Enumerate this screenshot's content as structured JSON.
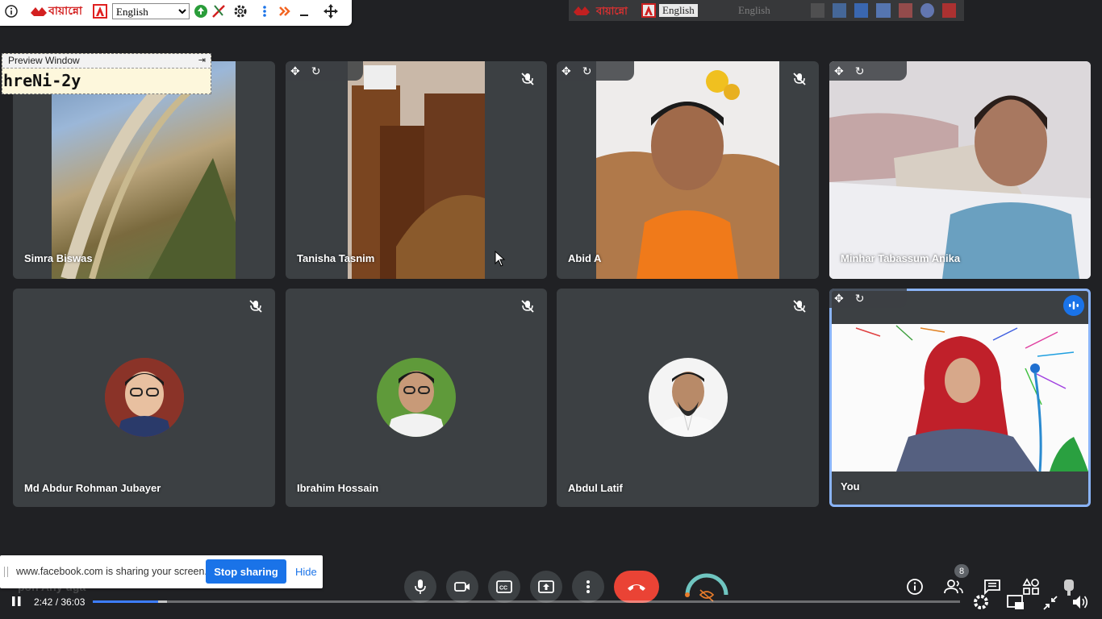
{
  "keyboard_toolbar": {
    "app_name": "বায়ান্নো",
    "language": "English",
    "icons": [
      "info-icon",
      "bayanno-logo-icon",
      "adobe-icon",
      "globe-icon",
      "scissors-icon",
      "gear-icon",
      "more-vertical-icon",
      "double-chevron-icon",
      "minimize-icon",
      "move-icon"
    ]
  },
  "keyboard_toolbar_ghost": {
    "app_name": "বায়ান্নো",
    "language": "English",
    "language2": "English"
  },
  "preview_window": {
    "title": "Preview Window",
    "text": "hreNi-2y"
  },
  "participants": [
    {
      "name": "Simra Biswas",
      "muted": false
    },
    {
      "name": "Tanisha Tasnim",
      "muted": true
    },
    {
      "name": "Abid A",
      "muted": true
    },
    {
      "name": "Minhar Tabassum Anika",
      "muted": false
    },
    {
      "name": "Md Abdur Rohman Jubayer",
      "muted": true
    },
    {
      "name": "Ibrahim Hossain",
      "muted": true
    },
    {
      "name": "Abdul Latif",
      "muted": true
    },
    {
      "name": "You",
      "muted": false,
      "speaking": true
    }
  ],
  "share_notice": {
    "text": "www.facebook.com is sharing your screen.",
    "stop_label": "Stop sharing",
    "hide_label": "Hide"
  },
  "meeting_controls": [
    "mic-icon",
    "camera-icon",
    "captions-icon",
    "present-icon",
    "more-options-icon",
    "end-call-icon"
  ],
  "right_controls": {
    "participants_count": "8",
    "icons": [
      "info-icon",
      "people-icon",
      "chat-icon",
      "activities-icon",
      "hand-icon"
    ]
  },
  "player": {
    "time": "2:42 / 36:03",
    "progress": 0.075,
    "ghost_caption": "pon Any uga"
  },
  "colors": {
    "accent": "#1a73e8",
    "end_call": "#ea4335",
    "tile_bg": "#3c4043",
    "bg": "#202124"
  }
}
